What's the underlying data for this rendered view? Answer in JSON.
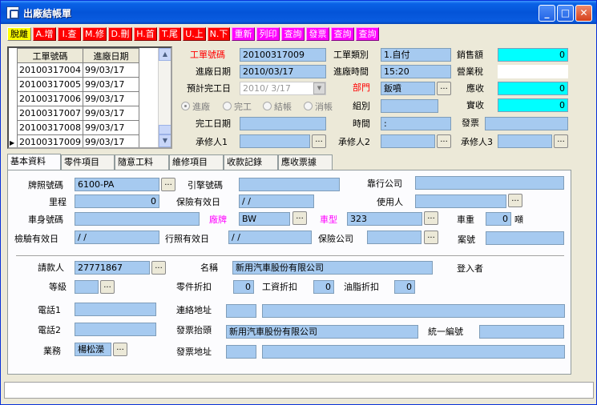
{
  "window": {
    "title": "出廠結帳單"
  },
  "toolbar": [
    {
      "label": "脫離",
      "color": "yellow"
    },
    {
      "label": "A.增",
      "color": "red"
    },
    {
      "label": "I.查",
      "color": "red"
    },
    {
      "label": "M.修",
      "color": "red"
    },
    {
      "label": "D.刪",
      "color": "red"
    },
    {
      "label": "H.首",
      "color": "red"
    },
    {
      "label": "T.尾",
      "color": "red"
    },
    {
      "label": "U.上",
      "color": "red"
    },
    {
      "label": "N.下",
      "color": "red"
    },
    {
      "label": "重新",
      "color": "magenta"
    },
    {
      "label": "列印",
      "color": "magenta"
    },
    {
      "label": "查詢",
      "color": "magenta"
    },
    {
      "label": "發票",
      "color": "magenta"
    },
    {
      "label": "查詢",
      "color": "magenta"
    },
    {
      "label": "查詢",
      "color": "magenta"
    }
  ],
  "list": {
    "columns": [
      "工單號碼",
      "進廠日期"
    ],
    "rows": [
      [
        "20100317004",
        "99/03/17"
      ],
      [
        "20100317005",
        "99/03/17"
      ],
      [
        "20100317006",
        "99/03/17"
      ],
      [
        "20100317007",
        "99/03/17"
      ],
      [
        "20100317008",
        "99/03/17"
      ],
      [
        "20100317009",
        "99/03/17"
      ]
    ]
  },
  "header": {
    "work_order_label": "工單號碼",
    "work_order": "20100317009",
    "entry_date_label": "進廠日期",
    "entry_date": "2010/03/17",
    "est_done_label": "預計完工日",
    "est_done": "2010/ 3/17",
    "work_type_label": "工單類別",
    "work_type": "1.自付",
    "entry_time_label": "進廠時間",
    "entry_time": "15:20",
    "dept_label": "部門",
    "dept": "鈑噴",
    "group_label": "組別",
    "group": "",
    "time_label": "時間",
    "time": " :",
    "done_date_label": "完工日期",
    "done_date": "",
    "handler1_label": "承修人1",
    "handler1": "",
    "handler2_label": "承修人2",
    "handler2": "",
    "handler3_label": "承修人3",
    "handler3": "",
    "status_radios": [
      "進廠",
      "完工",
      "結帳",
      "消帳"
    ],
    "sales_amount_label": "銷售額",
    "sales_amount": "0",
    "tax_label": "營業稅",
    "tax": "",
    "receivable_label": "應收",
    "receivable": "0",
    "received_label": "實收",
    "received": "0",
    "invoice_label": "發票",
    "invoice": ""
  },
  "tabs": [
    "基本資料",
    "零件項目",
    "隨意工料",
    "維修項目",
    "收款記錄",
    "應收票據"
  ],
  "basic": {
    "plate_label": "牌照號碼",
    "plate": "6100-PA",
    "engine_label": "引擎號碼",
    "engine": "",
    "affiliate_label": "靠行公司",
    "affiliate": "",
    "mileage_label": "里程",
    "mileage": "0",
    "insurance_date_label": "保險有效日",
    "insurance_date": "  /  /",
    "user_label": "使用人",
    "user": "",
    "chassis_label": "車身號碼",
    "chassis": "",
    "brand_label": "廠牌",
    "brand": "BW",
    "model_label": "車型",
    "model": "323",
    "weight_label": "車重",
    "weight": "0",
    "weight_unit": "噸",
    "inspect_date_label": "檢驗有效日",
    "inspect_date": "  /  /",
    "license_date_label": "行照有效日",
    "license_date": "  /  /",
    "insurer_label": "保險公司",
    "insurer": "",
    "case_no_label": "案號",
    "case_no": "",
    "payer_label": "請款人",
    "payer": "27771867",
    "name_label": "名稱",
    "name": "新用汽車股份有限公司",
    "login_label": "登入者",
    "level_label": "等級",
    "level": "",
    "parts_discount_label": "零件折扣",
    "parts_discount": "0",
    "labor_discount_label": "工資折扣",
    "labor_discount": "0",
    "oil_discount_label": "油脂折扣",
    "oil_discount": "0",
    "phone1_label": "電話1",
    "phone1": "",
    "address_label": "連絡地址",
    "address_code": "",
    "address": "",
    "phone2_label": "電話2",
    "phone2": "",
    "invoice_title_label": "發票抬頭",
    "invoice_title": "新用汽車股份有限公司",
    "tax_id_label": "統一編號",
    "tax_id": "",
    "sales_label": "業務",
    "sales": "楊松濚",
    "invoice_address_label": "發票地址",
    "invoice_address_code": "",
    "invoice_address": ""
  },
  "colors": {
    "field": "#a6caf0",
    "cyan": "#00ffff",
    "red": "#ff0000",
    "magenta": "#ff00ff",
    "yellow": "#ffff00"
  }
}
